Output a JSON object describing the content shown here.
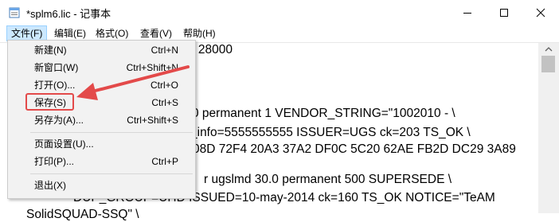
{
  "window": {
    "title": "*splm6.lic - 记事本",
    "buttons": [
      "minimize",
      "maximize",
      "close"
    ]
  },
  "menubar": {
    "items": [
      {
        "label": "文件(F)",
        "active": true
      },
      {
        "label": "编辑(E)"
      },
      {
        "label": "格式(O)"
      },
      {
        "label": "查看(V)"
      },
      {
        "label": "帮助(H)"
      }
    ]
  },
  "file_menu": {
    "items": [
      {
        "label": "新建(N)",
        "shortcut": "Ctrl+N"
      },
      {
        "label": "新窗口(W)",
        "shortcut": "Ctrl+Shift+N"
      },
      {
        "label": "打开(O)...",
        "shortcut": "Ctrl+O"
      },
      {
        "label": "保存(S)",
        "shortcut": "Ctrl+S",
        "annotated": true
      },
      {
        "label": "另存为(A)...",
        "shortcut": "Ctrl+Shift+S"
      },
      {
        "label": "页面设置(U)...",
        "shortcut": ""
      },
      {
        "label": "打印(P)...",
        "shortcut": "Ctrl+P"
      },
      {
        "label": "退出(X)",
        "shortcut": ""
      }
    ]
  },
  "editor": {
    "lines": [
      "5 28000",
      "0 permanent 1 VENDOR_STRING=\"1002010 - \\",
      "_info=5555555555 ISSUER=UGS ck=203 TS_OK \\",
      "08D 72F4 20A3 37A2 DF0C 5C20 62AE FB2D DC29 3A89",
      "r ugslmd 30.0 permanent 500 SUPERSEDE \\",
      "DUP_GROUP=UHD ISSUED=10-may-2014 ck=160 TS_OK NOTICE=\"TeAM",
      "SolidSQUAD-SSQ\" \\"
    ]
  },
  "annotation": {
    "color": "#e34a4a"
  }
}
